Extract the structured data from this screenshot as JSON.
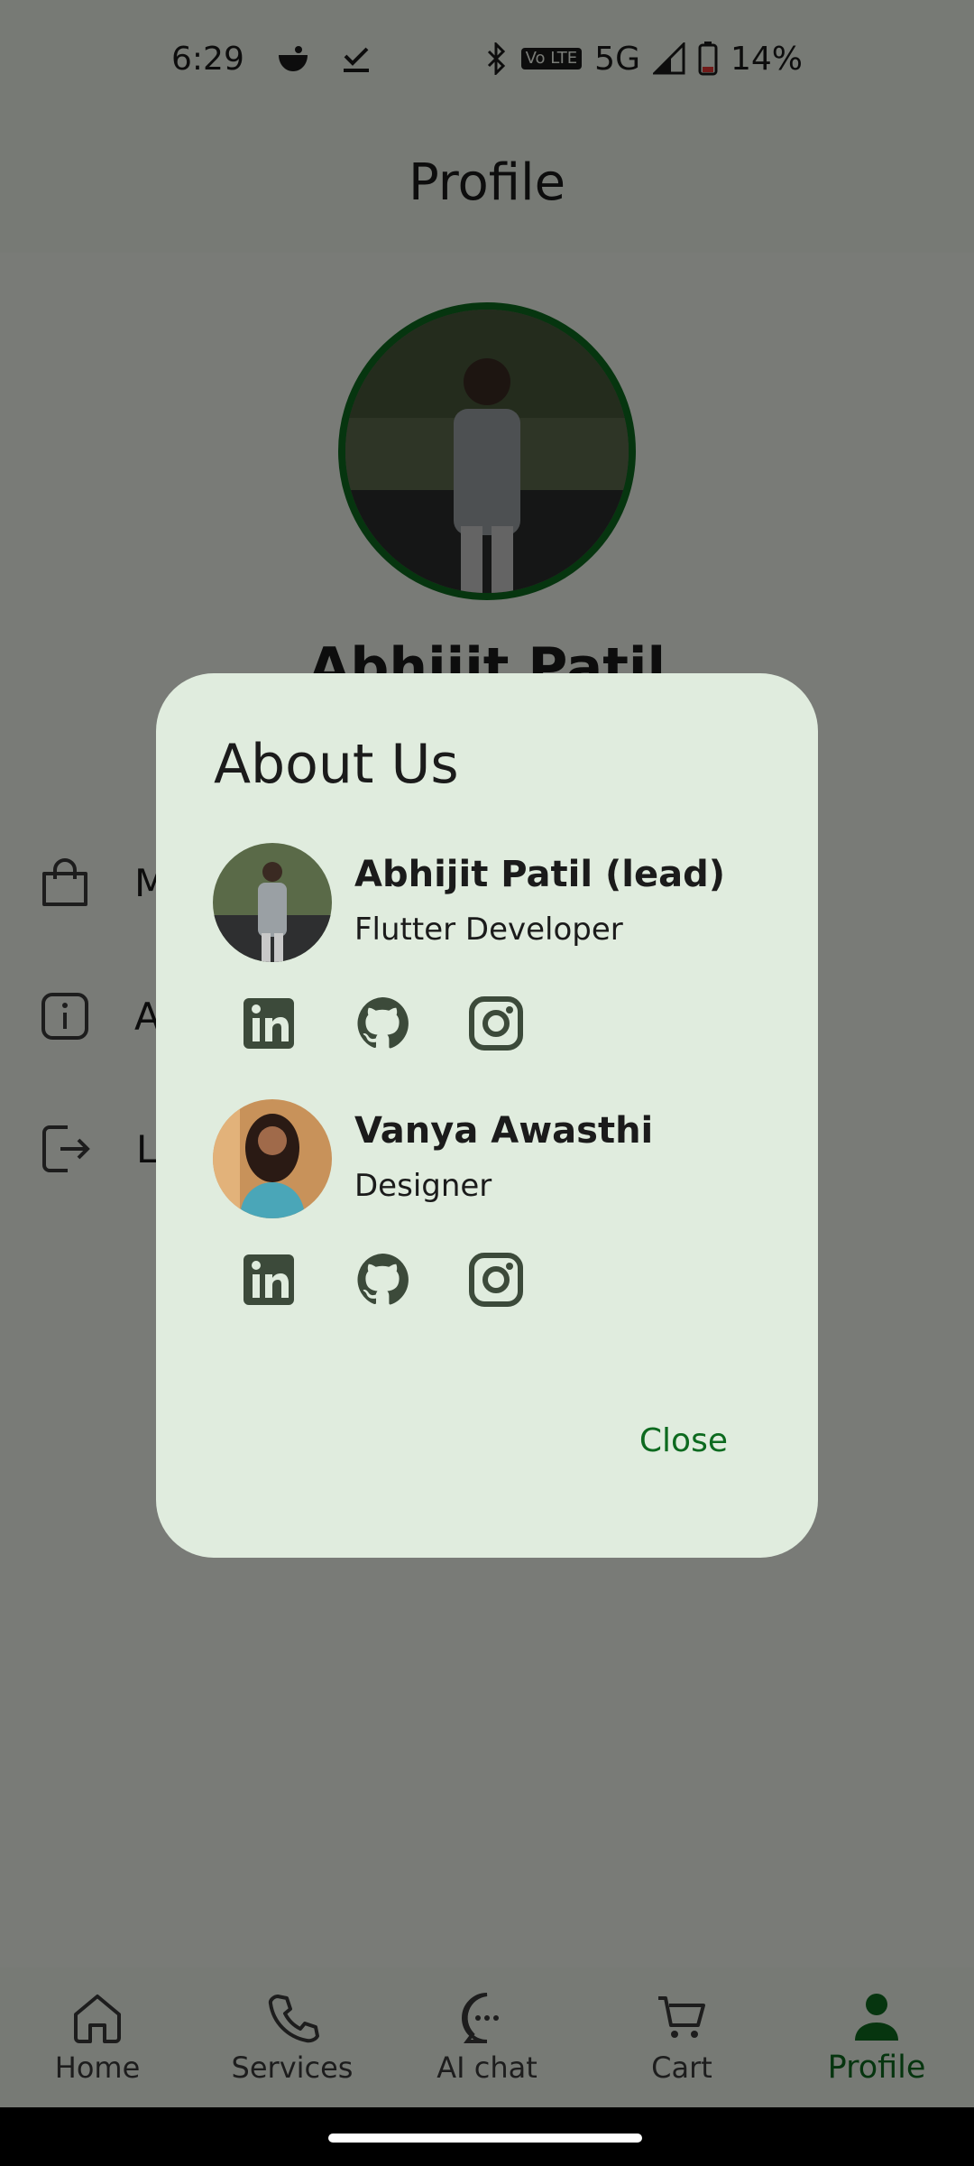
{
  "status_bar": {
    "time": "6:29",
    "network": "5G",
    "volte_badge": "Vo LTE",
    "battery": "14%",
    "icons": [
      "notification-icon",
      "download-done-icon",
      "bluetooth-icon",
      "signal-icon",
      "battery-icon"
    ]
  },
  "header": {
    "title": "Profile"
  },
  "profile": {
    "name": "Abhijit Patil",
    "menu": [
      {
        "label": "M",
        "icon": "bag-icon"
      },
      {
        "label": "A",
        "icon": "info-icon"
      },
      {
        "label": "L",
        "icon": "logout-icon"
      }
    ]
  },
  "dialog": {
    "title": "About Us",
    "members": [
      {
        "name": "Abhijit Patil (lead)",
        "role": "Flutter Developer",
        "socials": [
          "linkedin-icon",
          "github-icon",
          "instagram-icon"
        ]
      },
      {
        "name": "Vanya Awasthi",
        "role": "Designer",
        "socials": [
          "linkedin-icon",
          "github-icon",
          "instagram-icon"
        ]
      }
    ],
    "close_label": "Close"
  },
  "bottom_nav": {
    "items": [
      {
        "label": "Home",
        "icon": "home-icon",
        "active": false
      },
      {
        "label": "Services",
        "icon": "phone-icon",
        "active": false
      },
      {
        "label": "AI chat",
        "icon": "chat-icon",
        "active": false
      },
      {
        "label": "Cart",
        "icon": "cart-icon",
        "active": false
      },
      {
        "label": "Profile",
        "icon": "person-icon",
        "active": true
      }
    ]
  },
  "colors": {
    "accent": "#0d6a1f",
    "dialog_bg": "#e0ecde",
    "icon": "#3c4a3a"
  }
}
